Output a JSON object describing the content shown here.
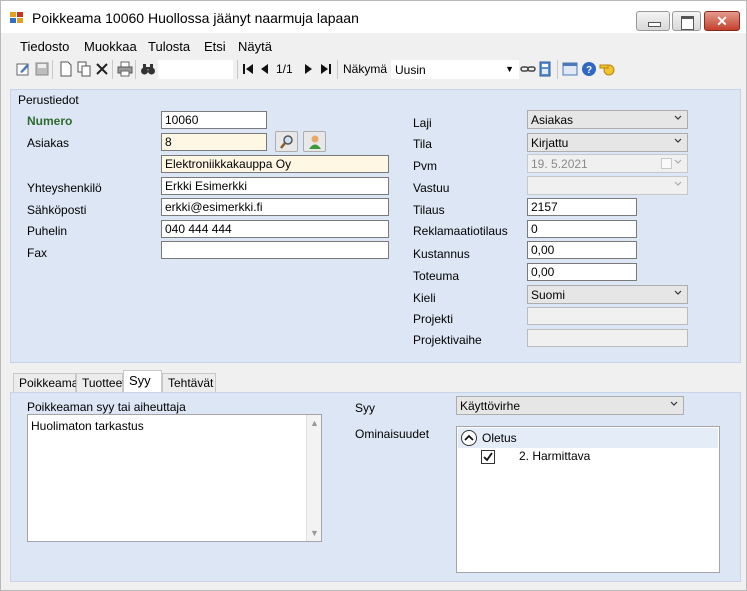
{
  "window": {
    "title": "Poikkeama 10060 Huollossa jäänyt naarmuja lapaan"
  },
  "menu": [
    "Tiedosto",
    "Muokkaa",
    "Tulosta",
    "Etsi",
    "Näytä"
  ],
  "toolbar": {
    "record": "1/1",
    "view_label": "Näkymä",
    "view_value": "Uusin"
  },
  "basic": {
    "group_label": "Perustiedot",
    "number_label": "Numero",
    "number_value": "10060",
    "customer_label": "Asiakas",
    "customer_value": "8",
    "customer_name": "Elektroniikkakauppa Oy",
    "contact_label": "Yhteyshenkilö",
    "contact_value": "Erkki Esimerkki",
    "email_label": "Sähköposti",
    "email_value": "erkki@esimerkki.fi",
    "phone_label": "Puhelin",
    "phone_value": "040 444 444",
    "fax_label": "Fax",
    "fax_value": ""
  },
  "right": {
    "type_label": "Laji",
    "type_value": "Asiakas",
    "status_label": "Tila",
    "status_value": "Kirjattu",
    "date_label": "Pvm",
    "date_value": "19. 5.2021",
    "owner_label": "Vastuu",
    "owner_value": "",
    "order_label": "Tilaus",
    "order_value": "2157",
    "claim_label": "Reklamaatiotilaus",
    "claim_value": "0",
    "cost_label": "Kustannus",
    "cost_value": "0,00",
    "actual_label": "Toteuma",
    "actual_value": "0,00",
    "lang_label": "Kieli",
    "lang_value": "Suomi",
    "project_label": "Projekti",
    "project_value": "",
    "phase_label": "Projektivaihe",
    "phase_value": ""
  },
  "tabs": [
    "Poikkeama",
    "Tuotteet",
    "Syy",
    "Tehtävät"
  ],
  "cause": {
    "area_label": "Poikkeaman syy tai aiheuttaja",
    "area_value": "Huolimaton tarkastus",
    "syy_label": "Syy",
    "syy_value": "Käyttövirhe",
    "props_label": "Ominaisuudet",
    "group_name": "Oletus",
    "item_label": "2. Harmittava",
    "item_checked": true
  }
}
